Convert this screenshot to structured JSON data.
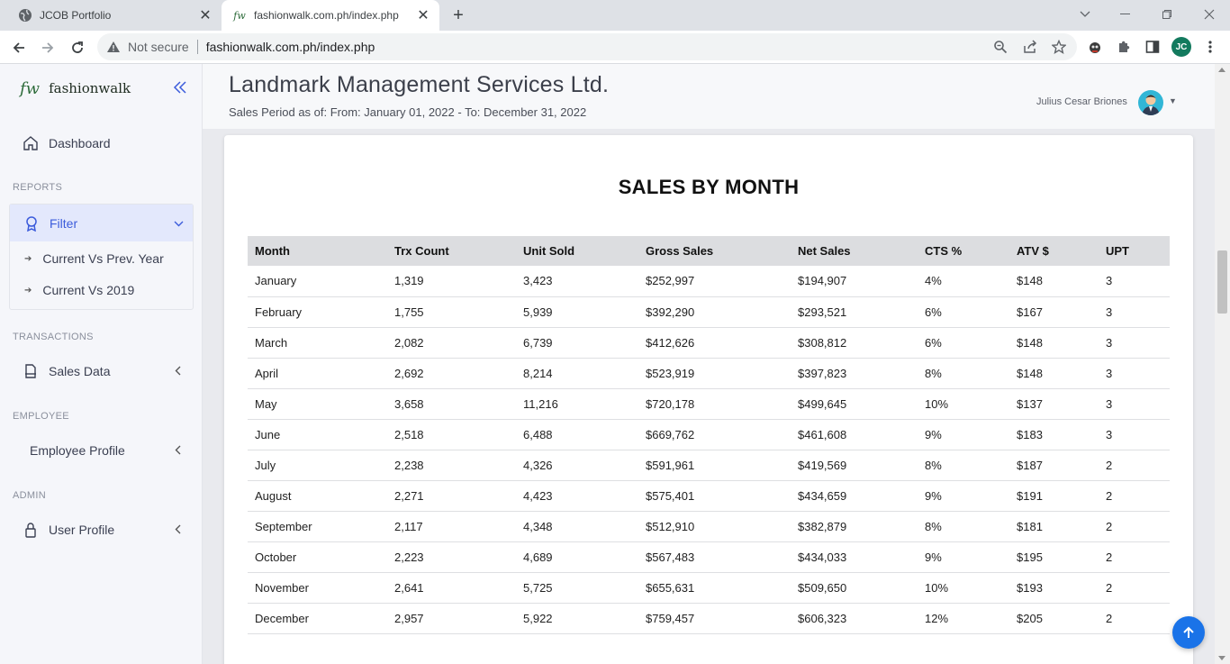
{
  "browser": {
    "tabs": [
      {
        "title": "JCOB Portfolio",
        "active": false,
        "icon": "globe-icon"
      },
      {
        "title": "fashionwalk.com.ph/index.php",
        "active": true,
        "icon": "fw-favicon-icon"
      }
    ],
    "security_label": "Not secure",
    "url": "fashionwalk.com.ph/index.php",
    "profile_initials": "JC"
  },
  "sidebar": {
    "brand_mark": "fw",
    "brand_name": "fashionwalk",
    "dashboard": "Dashboard",
    "sections": {
      "reports": "REPORTS",
      "transactions": "TRANSACTIONS",
      "employee": "EMPLOYEE",
      "admin": "ADMIN"
    },
    "filter": {
      "label": "Filter",
      "items": [
        "Current Vs Prev. Year",
        "Current Vs 2019"
      ]
    },
    "sales_data": "Sales Data",
    "employee_profile": "Employee Profile",
    "user_profile": "User Profile"
  },
  "header": {
    "company": "Landmark Management Services Ltd.",
    "period": "Sales Period as of: From: January 01, 2022 - To: December 31, 2022",
    "user_name": "Julius Cesar Briones"
  },
  "report": {
    "title": "SALES BY MONTH",
    "columns": [
      "Month",
      "Trx Count",
      "Unit Sold",
      "Gross Sales",
      "Net Sales",
      "CTS %",
      "ATV $",
      "UPT"
    ],
    "rows": [
      [
        "January",
        "1,319",
        "3,423",
        "$252,997",
        "$194,907",
        "4%",
        "$148",
        "3"
      ],
      [
        "February",
        "1,755",
        "5,939",
        "$392,290",
        "$293,521",
        "6%",
        "$167",
        "3"
      ],
      [
        "March",
        "2,082",
        "6,739",
        "$412,626",
        "$308,812",
        "6%",
        "$148",
        "3"
      ],
      [
        "April",
        "2,692",
        "8,214",
        "$523,919",
        "$397,823",
        "8%",
        "$148",
        "3"
      ],
      [
        "May",
        "3,658",
        "11,216",
        "$720,178",
        "$499,645",
        "10%",
        "$137",
        "3"
      ],
      [
        "June",
        "2,518",
        "6,488",
        "$669,762",
        "$461,608",
        "9%",
        "$183",
        "3"
      ],
      [
        "July",
        "2,238",
        "4,326",
        "$591,961",
        "$419,569",
        "8%",
        "$187",
        "2"
      ],
      [
        "August",
        "2,271",
        "4,423",
        "$575,401",
        "$434,659",
        "9%",
        "$191",
        "2"
      ],
      [
        "September",
        "2,117",
        "4,348",
        "$512,910",
        "$382,879",
        "8%",
        "$181",
        "2"
      ],
      [
        "October",
        "2,223",
        "4,689",
        "$567,483",
        "$434,033",
        "9%",
        "$195",
        "2"
      ],
      [
        "November",
        "2,641",
        "5,725",
        "$655,631",
        "$509,650",
        "10%",
        "$193",
        "2"
      ],
      [
        "December",
        "2,957",
        "5,922",
        "$759,457",
        "$606,323",
        "12%",
        "$205",
        "2"
      ]
    ]
  },
  "colors": {
    "accent": "#3b5bdb",
    "fab": "#1a73e8",
    "table_header_bg": "#dcdde0"
  }
}
